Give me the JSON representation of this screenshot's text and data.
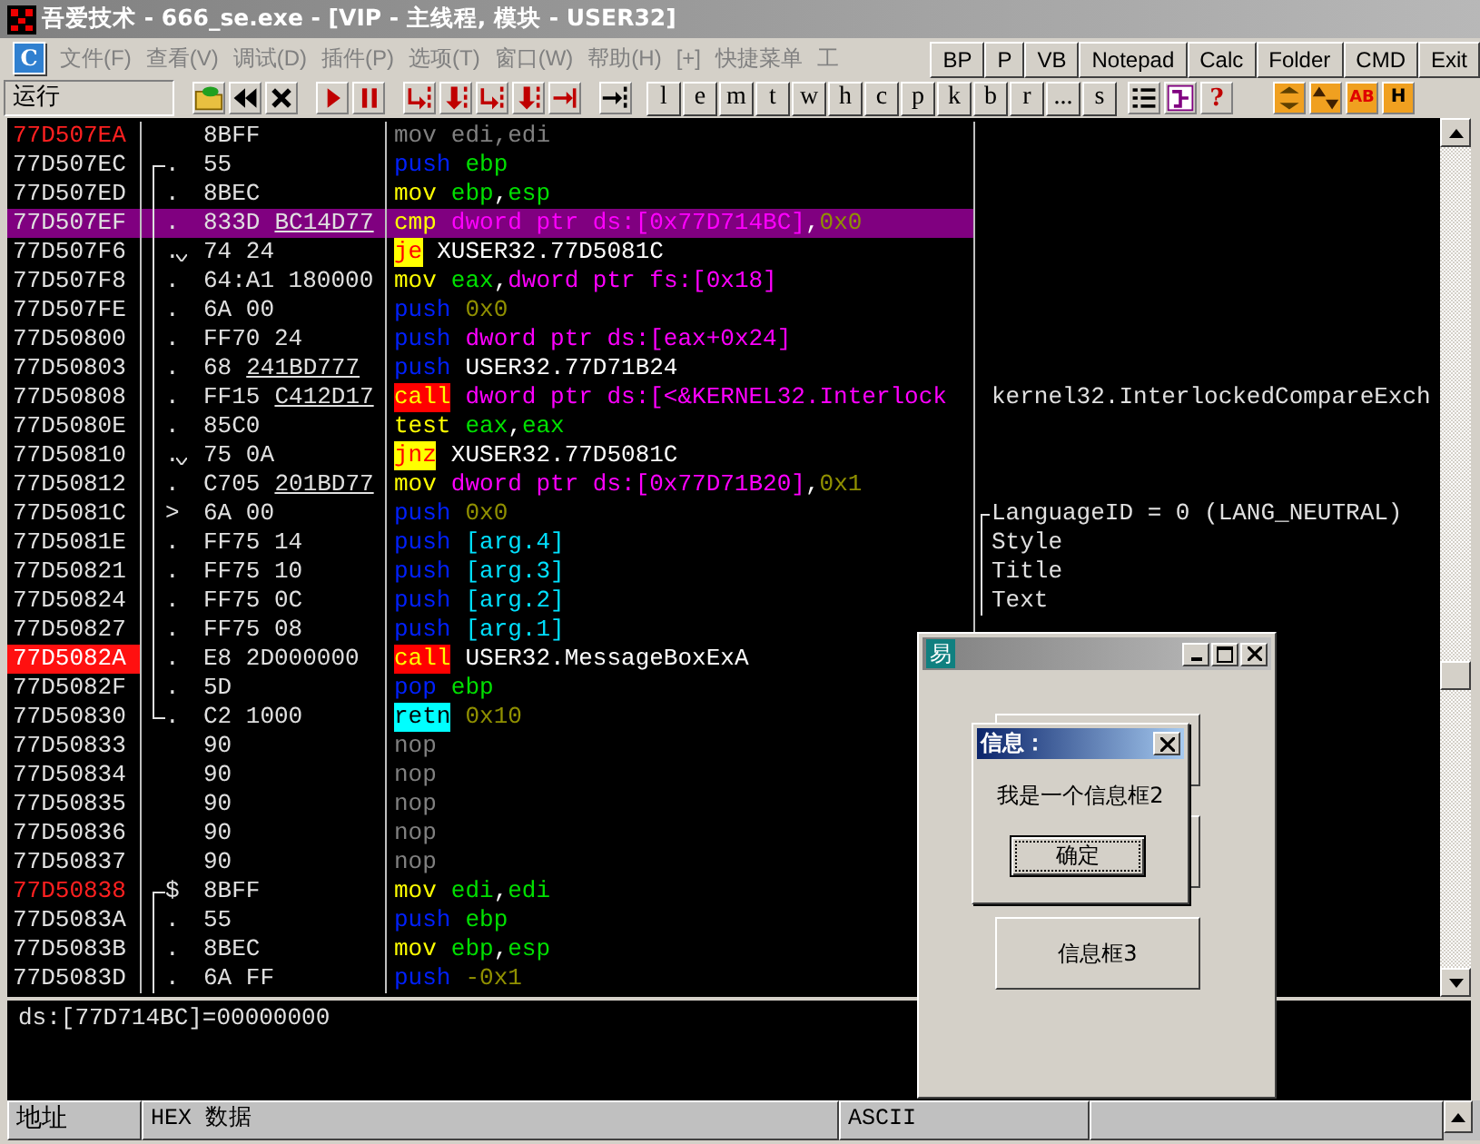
{
  "window": {
    "title": "吾爱技术 - 666_se.exe - [VIP - 主线程, 模块 - USER32]"
  },
  "app_button": "C",
  "menu": [
    "文件(F)",
    "查看(V)",
    "调试(D)",
    "插件(P)",
    "选项(T)",
    "窗口(W)",
    "帮助(H)",
    "[+]",
    "快捷菜单",
    "工"
  ],
  "quick_buttons": [
    "BP",
    "P",
    "VB",
    "Notepad",
    "Calc",
    "Folder",
    "CMD",
    "Exit"
  ],
  "status": "运行",
  "tools": [
    {
      "kind": "open"
    },
    {
      "kind": "rewind"
    },
    {
      "kind": "close"
    },
    {
      "kind": "run"
    },
    {
      "kind": "pause"
    },
    {
      "kind": "step-in"
    },
    {
      "kind": "step-over"
    },
    {
      "kind": "trace-in"
    },
    {
      "kind": "trace-over"
    },
    {
      "kind": "till-return"
    },
    {
      "kind": "goto"
    }
  ],
  "letter_buttons": [
    "l",
    "e",
    "m",
    "t",
    "w",
    "h",
    "c",
    "p",
    "k",
    "b",
    "r",
    "...",
    "s"
  ],
  "tools_right": [
    {
      "kind": "list"
    },
    {
      "kind": "grid"
    },
    {
      "kind": "help",
      "text": "?"
    },
    {
      "kind": "arrows"
    },
    {
      "kind": "updown"
    },
    {
      "kind": "ab",
      "text": "AB"
    },
    {
      "kind": "hb",
      "text": "H"
    }
  ],
  "disassembly": {
    "rows": [
      {
        "addr": {
          "text": "77D507EA",
          "kind": "label"
        },
        "selected": false,
        "bytes": "8BFF",
        "mnemonic": {
          "text": "mov",
          "kind": "dim"
        },
        "operands": [
          {
            "text": "edi,edi",
            "kind": "dim"
          }
        ]
      },
      {
        "addr": {
          "text": "77D507EC",
          "kind": "plain"
        },
        "selected": false,
        "bracket": {
          "kind": "start"
        },
        "mark": {
          "text": ".",
          "kind": "plain"
        },
        "bytes": "55",
        "mnemonic": {
          "text": "push",
          "kind": "stack"
        },
        "operands": [
          {
            "text": "ebp",
            "kind": "reg"
          }
        ]
      },
      {
        "addr": {
          "text": "77D507ED",
          "kind": "plain"
        },
        "selected": false,
        "bracket": {
          "kind": "mid"
        },
        "mark": {
          "text": ".",
          "kind": "plain"
        },
        "bytes": "8BEC",
        "mnemonic": {
          "text": "mov",
          "kind": "move"
        },
        "operands": [
          {
            "text": "ebp",
            "kind": "reg"
          },
          {
            "text": ",",
            "kind": "punct"
          },
          {
            "text": "esp",
            "kind": "reg"
          }
        ]
      },
      {
        "addr": {
          "text": "77D507EF",
          "kind": "plain"
        },
        "selected": true,
        "bracket": {
          "kind": "mid"
        },
        "mark": {
          "text": ".",
          "kind": "plain"
        },
        "bytes": "833D",
        "bytes_ref": "BC14D77",
        "mnemonic": {
          "text": "cmp",
          "kind": "move"
        },
        "operands": [
          {
            "text": "dword ptr ds:[0x77D714BC]",
            "kind": "mem"
          },
          {
            "text": ",",
            "kind": "punct"
          },
          {
            "text": "0x0",
            "kind": "num"
          }
        ]
      },
      {
        "addr": {
          "text": "77D507F6",
          "kind": "plain"
        },
        "selected": false,
        "bracket": {
          "kind": "mid"
        },
        "mark": {
          "text": ".",
          "kind": "jump"
        },
        "bytes": "74 24",
        "mnemonic": {
          "text": "je",
          "kind": "jump"
        },
        "operands": [
          {
            "text": "XUSER32.77D5081C",
            "kind": "sym"
          }
        ]
      },
      {
        "addr": {
          "text": "77D507F8",
          "kind": "plain"
        },
        "selected": false,
        "bracket": {
          "kind": "mid"
        },
        "mark": {
          "text": ".",
          "kind": "plain"
        },
        "bytes": "64:A1 180000",
        "mnemonic": {
          "text": "mov",
          "kind": "move"
        },
        "operands": [
          {
            "text": "eax",
            "kind": "reg"
          },
          {
            "text": ",",
            "kind": "punct"
          },
          {
            "text": "dword ptr fs:[0x18]",
            "kind": "mem"
          }
        ]
      },
      {
        "addr": {
          "text": "77D507FE",
          "kind": "plain"
        },
        "selected": false,
        "bracket": {
          "kind": "mid"
        },
        "mark": {
          "text": ".",
          "kind": "plain"
        },
        "bytes": "6A 00",
        "mnemonic": {
          "text": "push",
          "kind": "stack"
        },
        "operands": [
          {
            "text": "0x0",
            "kind": "num"
          }
        ]
      },
      {
        "addr": {
          "text": "77D50800",
          "kind": "plain"
        },
        "selected": false,
        "bracket": {
          "kind": "mid"
        },
        "mark": {
          "text": ".",
          "kind": "plain"
        },
        "bytes": "FF70 24",
        "mnemonic": {
          "text": "push",
          "kind": "stack"
        },
        "operands": [
          {
            "text": "dword ptr ds:[eax+0x24]",
            "kind": "mem"
          }
        ]
      },
      {
        "addr": {
          "text": "77D50803",
          "kind": "plain"
        },
        "selected": false,
        "bracket": {
          "kind": "mid"
        },
        "mark": {
          "text": ".",
          "kind": "plain"
        },
        "bytes": "68",
        "bytes_ref": "241BD777",
        "mnemonic": {
          "text": "push",
          "kind": "stack"
        },
        "operands": [
          {
            "text": "USER32.77D71B24",
            "kind": "sym"
          }
        ]
      },
      {
        "addr": {
          "text": "77D50808",
          "kind": "plain"
        },
        "selected": false,
        "bracket": {
          "kind": "mid"
        },
        "mark": {
          "text": ".",
          "kind": "plain"
        },
        "bytes": "FF15",
        "bytes_ref": "C412D17",
        "mnemonic": {
          "text": "call",
          "kind": "call"
        },
        "operands": [
          {
            "text": "dword ptr ds:[<&KERNEL32.Interlock",
            "kind": "mem"
          }
        ],
        "comment": {
          "text": "kernel32.InterlockedCompareExch",
          "kind": "plain"
        }
      },
      {
        "addr": {
          "text": "77D5080E",
          "kind": "plain"
        },
        "selected": false,
        "bracket": {
          "kind": "mid"
        },
        "mark": {
          "text": ".",
          "kind": "plain"
        },
        "bytes": "85C0",
        "mnemonic": {
          "text": "test",
          "kind": "move"
        },
        "operands": [
          {
            "text": "eax",
            "kind": "reg"
          },
          {
            "text": ",",
            "kind": "punct"
          },
          {
            "text": "eax",
            "kind": "reg"
          }
        ]
      },
      {
        "addr": {
          "text": "77D50810",
          "kind": "plain"
        },
        "selected": false,
        "bracket": {
          "kind": "mid"
        },
        "mark": {
          "text": ".",
          "kind": "jump"
        },
        "bytes": "75 0A",
        "mnemonic": {
          "text": "jnz",
          "kind": "jump"
        },
        "operands": [
          {
            "text": "XUSER32.77D5081C",
            "kind": "sym"
          }
        ]
      },
      {
        "addr": {
          "text": "77D50812",
          "kind": "plain"
        },
        "selected": false,
        "bracket": {
          "kind": "mid"
        },
        "mark": {
          "text": ".",
          "kind": "plain"
        },
        "bytes": "C705",
        "bytes_ref": "201BD77",
        "mnemonic": {
          "text": "mov",
          "kind": "move"
        },
        "operands": [
          {
            "text": "dword ptr ds:[0x77D71B20]",
            "kind": "mem"
          },
          {
            "text": ",",
            "kind": "punct"
          },
          {
            "text": "0x1",
            "kind": "num"
          }
        ]
      },
      {
        "addr": {
          "text": "77D5081C",
          "kind": "plain"
        },
        "selected": false,
        "bracket": {
          "kind": "mid"
        },
        "mark": {
          "text": ">",
          "kind": "plain"
        },
        "bytes": "6A 00",
        "mnemonic": {
          "text": "push",
          "kind": "stack"
        },
        "operands": [
          {
            "text": "0x0",
            "kind": "num"
          }
        ],
        "comment": {
          "text": "LanguageID = 0 (LANG_NEUTRAL)",
          "kind": "bracket-start"
        }
      },
      {
        "addr": {
          "text": "77D5081E",
          "kind": "plain"
        },
        "selected": false,
        "bracket": {
          "kind": "mid"
        },
        "mark": {
          "text": ".",
          "kind": "plain"
        },
        "bytes": "FF75 14",
        "mnemonic": {
          "text": "push",
          "kind": "stack"
        },
        "operands": [
          {
            "text": "[arg.4]",
            "kind": "arg"
          }
        ],
        "comment": {
          "text": "Style",
          "kind": "bracket-mid"
        }
      },
      {
        "addr": {
          "text": "77D50821",
          "kind": "plain"
        },
        "selected": false,
        "bracket": {
          "kind": "mid"
        },
        "mark": {
          "text": ".",
          "kind": "plain"
        },
        "bytes": "FF75 10",
        "mnemonic": {
          "text": "push",
          "kind": "stack"
        },
        "operands": [
          {
            "text": "[arg.3]",
            "kind": "arg"
          }
        ],
        "comment": {
          "text": "Title",
          "kind": "bracket-mid"
        }
      },
      {
        "addr": {
          "text": "77D50824",
          "kind": "plain"
        },
        "selected": false,
        "bracket": {
          "kind": "mid"
        },
        "mark": {
          "text": ".",
          "kind": "plain"
        },
        "bytes": "FF75 0C",
        "mnemonic": {
          "text": "push",
          "kind": "stack"
        },
        "operands": [
          {
            "text": "[arg.2]",
            "kind": "arg"
          }
        ],
        "comment": {
          "text": "Text",
          "kind": "bracket-mid"
        }
      },
      {
        "addr": {
          "text": "77D50827",
          "kind": "plain"
        },
        "selected": false,
        "bracket": {
          "kind": "mid"
        },
        "mark": {
          "text": ".",
          "kind": "plain"
        },
        "bytes": "FF75 08",
        "mnemonic": {
          "text": "push",
          "kind": "stack"
        },
        "operands": [
          {
            "text": "[arg.1]",
            "kind": "arg"
          }
        ]
      },
      {
        "addr": {
          "text": "77D5082A",
          "kind": "breakpoint"
        },
        "selected": false,
        "bracket": {
          "kind": "mid"
        },
        "mark": {
          "text": ".",
          "kind": "plain"
        },
        "bytes": "E8 2D000000",
        "mnemonic": {
          "text": "call",
          "kind": "call"
        },
        "operands": [
          {
            "text": "USER32.MessageBoxExA",
            "kind": "sym"
          }
        ]
      },
      {
        "addr": {
          "text": "77D5082F",
          "kind": "plain"
        },
        "selected": false,
        "bracket": {
          "kind": "mid"
        },
        "mark": {
          "text": ".",
          "kind": "plain"
        },
        "bytes": "5D",
        "mnemonic": {
          "text": "pop",
          "kind": "stack"
        },
        "operands": [
          {
            "text": "ebp",
            "kind": "reg"
          }
        ]
      },
      {
        "addr": {
          "text": "77D50830",
          "kind": "plain"
        },
        "selected": false,
        "bracket": {
          "kind": "end"
        },
        "mark": {
          "text": ".",
          "kind": "plain"
        },
        "bytes": "C2 1000",
        "mnemonic": {
          "text": "retn",
          "kind": "ret"
        },
        "operands": [
          {
            "text": "0x10",
            "kind": "num"
          }
        ]
      },
      {
        "addr": {
          "text": "77D50833",
          "kind": "plain"
        },
        "selected": false,
        "bytes": "90",
        "mnemonic": {
          "text": "nop",
          "kind": "nop"
        },
        "operands": []
      },
      {
        "addr": {
          "text": "77D50834",
          "kind": "plain"
        },
        "selected": false,
        "bytes": "90",
        "mnemonic": {
          "text": "nop",
          "kind": "nop"
        },
        "operands": []
      },
      {
        "addr": {
          "text": "77D50835",
          "kind": "plain"
        },
        "selected": false,
        "bytes": "90",
        "mnemonic": {
          "text": "nop",
          "kind": "nop"
        },
        "operands": []
      },
      {
        "addr": {
          "text": "77D50836",
          "kind": "plain"
        },
        "selected": false,
        "bytes": "90",
        "mnemonic": {
          "text": "nop",
          "kind": "nop"
        },
        "operands": []
      },
      {
        "addr": {
          "text": "77D50837",
          "kind": "plain"
        },
        "selected": false,
        "bytes": "90",
        "mnemonic": {
          "text": "nop",
          "kind": "nop"
        },
        "operands": []
      },
      {
        "addr": {
          "text": "77D50838",
          "kind": "label"
        },
        "selected": false,
        "bracket": {
          "kind": "start"
        },
        "mark": {
          "text": "$",
          "kind": "plain"
        },
        "bytes": "8BFF",
        "mnemonic": {
          "text": "mov",
          "kind": "move"
        },
        "operands": [
          {
            "text": "edi",
            "kind": "reg"
          },
          {
            "text": ",",
            "kind": "punct"
          },
          {
            "text": "edi",
            "kind": "reg"
          }
        ]
      },
      {
        "addr": {
          "text": "77D5083A",
          "kind": "plain"
        },
        "selected": false,
        "bracket": {
          "kind": "mid"
        },
        "mark": {
          "text": ".",
          "kind": "plain"
        },
        "bytes": "55",
        "mnemonic": {
          "text": "push",
          "kind": "stack"
        },
        "operands": [
          {
            "text": "ebp",
            "kind": "reg"
          }
        ]
      },
      {
        "addr": {
          "text": "77D5083B",
          "kind": "plain"
        },
        "selected": false,
        "bracket": {
          "kind": "mid"
        },
        "mark": {
          "text": ".",
          "kind": "plain"
        },
        "bytes": "8BEC",
        "mnemonic": {
          "text": "mov",
          "kind": "move"
        },
        "operands": [
          {
            "text": "ebp",
            "kind": "reg"
          },
          {
            "text": ",",
            "kind": "punct"
          },
          {
            "text": "esp",
            "kind": "reg"
          }
        ]
      },
      {
        "addr": {
          "text": "77D5083D",
          "kind": "plain"
        },
        "selected": false,
        "bracket": {
          "kind": "mid"
        },
        "mark": {
          "text": ".",
          "kind": "plain"
        },
        "bytes": "6A FF",
        "mnemonic": {
          "text": "push",
          "kind": "stack"
        },
        "operands": [
          {
            "text": "-0x1",
            "kind": "num"
          }
        ]
      }
    ]
  },
  "info": "ds:[77D714BC]=00000000",
  "dump": {
    "columns": [
      "地址",
      "HEX 数据",
      "ASCII"
    ]
  },
  "dialog": {
    "icon_glyph": "易",
    "button": "信息框3"
  },
  "message_box": {
    "title": "信息：",
    "text": "我是一个信息框2",
    "button": "确定"
  }
}
